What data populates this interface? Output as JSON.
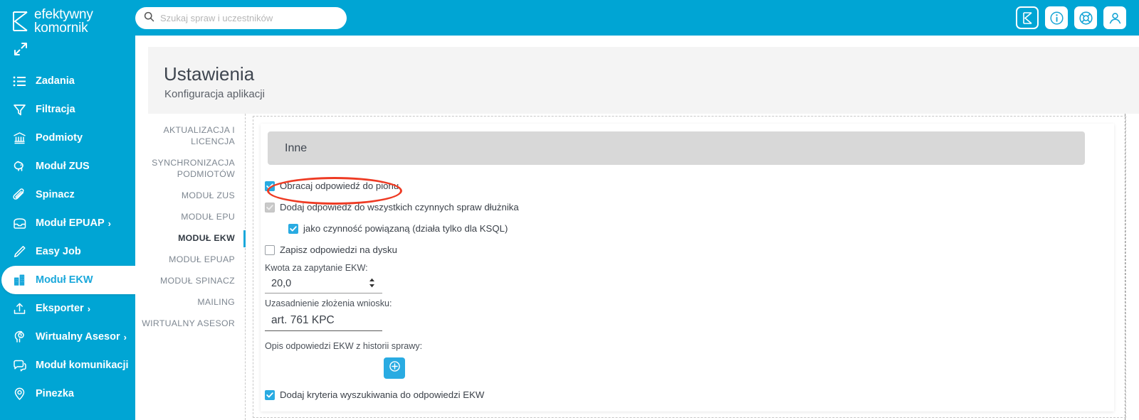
{
  "brand": {
    "line1": "efektywny",
    "line2": "komornik",
    "logo_icon": "k-logo-icon"
  },
  "sidebar": {
    "expand_icon": "expand-arrows-icon",
    "items": [
      {
        "label": "Zadania",
        "icon": "list-icon",
        "chevron": "",
        "active": false
      },
      {
        "label": "Filtracja",
        "icon": "filter-icon",
        "chevron": "",
        "active": false
      },
      {
        "label": "Podmioty",
        "icon": "bank-icon",
        "chevron": "",
        "active": false
      },
      {
        "label": "Moduł ZUS",
        "icon": "piggy-bank-icon",
        "chevron": "",
        "active": false
      },
      {
        "label": "Spinacz",
        "icon": "paperclip-icon",
        "chevron": "",
        "active": false
      },
      {
        "label": "Moduł EPUAP",
        "icon": "inbox-icon",
        "chevron": "›",
        "active": false
      },
      {
        "label": "Easy Job",
        "icon": "pencil-icon",
        "chevron": "",
        "active": false
      },
      {
        "label": "Moduł EKW",
        "icon": "building-icon",
        "chevron": "",
        "active": true
      },
      {
        "label": "Eksporter",
        "icon": "upload-icon",
        "chevron": "›",
        "active": false
      },
      {
        "label": "Wirtualny Asesor",
        "icon": "brain-icon",
        "chevron": "›",
        "active": false
      },
      {
        "label": "Moduł komunikacji",
        "icon": "chat-icon",
        "chevron": "",
        "active": false
      },
      {
        "label": "Pinezka",
        "icon": "map-pin-icon",
        "chevron": "",
        "active": false
      }
    ]
  },
  "topbar": {
    "search": {
      "value": "",
      "placeholder": "Szukaj spraw i uczestników",
      "icon": "search-icon"
    },
    "icons": [
      {
        "name": "k-logo-button-icon",
        "filled": true
      },
      {
        "name": "info-circle-icon",
        "filled": false
      },
      {
        "name": "lifebuoy-support-icon",
        "filled": false
      },
      {
        "name": "user-account-icon",
        "filled": false
      }
    ]
  },
  "header": {
    "title": "Ustawienia",
    "subtitle": "Konfiguracja aplikacji"
  },
  "tabs": [
    {
      "label": "AKTUALIZACJA I LICENCJA",
      "active": false
    },
    {
      "label": "SYNCHRONIZACJA PODMIOTÓW",
      "active": false
    },
    {
      "label": "MODUŁ ZUS",
      "active": false
    },
    {
      "label": "MODUŁ EPU",
      "active": false
    },
    {
      "label": "MODUŁ EKW",
      "active": true
    },
    {
      "label": "MODUŁ EPUAP",
      "active": false
    },
    {
      "label": "MODUŁ SPINACZ",
      "active": false
    },
    {
      "label": "MAILING",
      "active": false
    },
    {
      "label": "WIRTUALNY ASESOR",
      "active": false
    }
  ],
  "section": {
    "title": "Inne"
  },
  "form": {
    "checkbox_rotate": {
      "label": "Obracaj odpowiedź do pionu",
      "checked": true,
      "disabled": false,
      "indent": false
    },
    "checkbox_add_all": {
      "label": "Dodaj odpowiedź do wszystkich czynnych spraw dłużnika",
      "checked": true,
      "disabled": true,
      "indent": false
    },
    "checkbox_related": {
      "label": "jako czynność powiązaną (działa tylko dla KSQL)",
      "checked": true,
      "disabled": false,
      "indent": true
    },
    "checkbox_save_disk": {
      "label": "Zapisz odpowiedzi na dysku",
      "checked": false,
      "disabled": false,
      "indent": false
    },
    "amount_label": "Kwota za zapytanie EKW:",
    "amount_value": "20,0",
    "reason_label": "Uzasadnienie złożenia wniosku:",
    "reason_value": "art. 761 KPC",
    "description_label": "Opis odpowiedzi EKW z historii sprawy:",
    "add_button_icon": "plus-circle-icon",
    "checkbox_criteria": {
      "label": "Dodaj kryteria wyszukiwania do odpowiedzi EKW",
      "checked": true,
      "disabled": false,
      "indent": false
    }
  },
  "annotation": {
    "shape": "ellipse",
    "color": "#ee3b24",
    "target": "Obracaj odpowiedź do pionu"
  },
  "colors": {
    "brand_blue": "#00a5d4",
    "accent_blue": "#29abe2",
    "panel_gray": "#d8d8d8",
    "header_gray": "#f4f4f4",
    "annotation_red": "#ee3b24"
  }
}
